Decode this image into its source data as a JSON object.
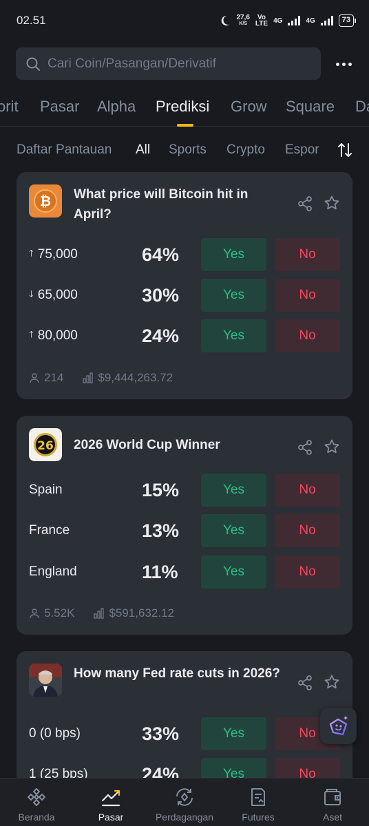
{
  "status_bar": {
    "time": "02.51",
    "speed_value": "27,6",
    "speed_unit": "K/S",
    "volte_top": "Vo",
    "volte_bottom": "LTE",
    "net1": "4G",
    "net2": "4G",
    "battery": "73"
  },
  "search": {
    "placeholder": "Cari Coin/Pasangan/Derivatif"
  },
  "main_tabs": [
    "orit",
    "Pasar",
    "Alpha",
    "Prediksi",
    "Grow",
    "Square",
    "Da"
  ],
  "active_main_tab": "Prediksi",
  "filters": [
    "Daftar Pantauan",
    "All",
    "Sports",
    "Crypto",
    "Espor"
  ],
  "active_filter": "All",
  "buttons": {
    "yes": "Yes",
    "no": "No"
  },
  "colors": {
    "yes": "#2ebd85",
    "no": "#f6465d",
    "accent": "#f0b90b",
    "card": "#2b2f36"
  },
  "cards": [
    {
      "icon": "bitcoin-icon",
      "title": "What price will Bitcoin hit in April?",
      "outcomes": [
        {
          "label": "75,000",
          "direction": "up",
          "pct": "64%"
        },
        {
          "label": "65,000",
          "direction": "down",
          "pct": "30%"
        },
        {
          "label": "80,000",
          "direction": "up",
          "pct": "24%"
        }
      ],
      "participants": "214",
      "volume": "$9,444,263.72"
    },
    {
      "icon": "world-cup-2026-icon",
      "icon_text": "26",
      "title": "2026 World Cup Winner",
      "outcomes": [
        {
          "label": "Spain",
          "pct": "15%"
        },
        {
          "label": "France",
          "pct": "13%"
        },
        {
          "label": "England",
          "pct": "11%"
        }
      ],
      "participants": "5.52K",
      "volume": "$591,632.12"
    },
    {
      "icon": "fed-chair-portrait-icon",
      "title": "How many Fed rate cuts in 2026?",
      "outcomes": [
        {
          "label": "0 (0 bps)",
          "pct": "33%"
        },
        {
          "label": "1 (25 bps)",
          "pct": "24%"
        }
      ]
    }
  ],
  "bottom_nav": [
    {
      "label": "Beranda",
      "icon": "binance-logo-icon"
    },
    {
      "label": "Pasar",
      "icon": "market-chart-icon"
    },
    {
      "label": "Perdagangan",
      "icon": "trade-swap-icon"
    },
    {
      "label": "Futures",
      "icon": "futures-doc-icon"
    },
    {
      "label": "Aset",
      "icon": "wallet-icon"
    }
  ],
  "active_nav": "Pasar"
}
